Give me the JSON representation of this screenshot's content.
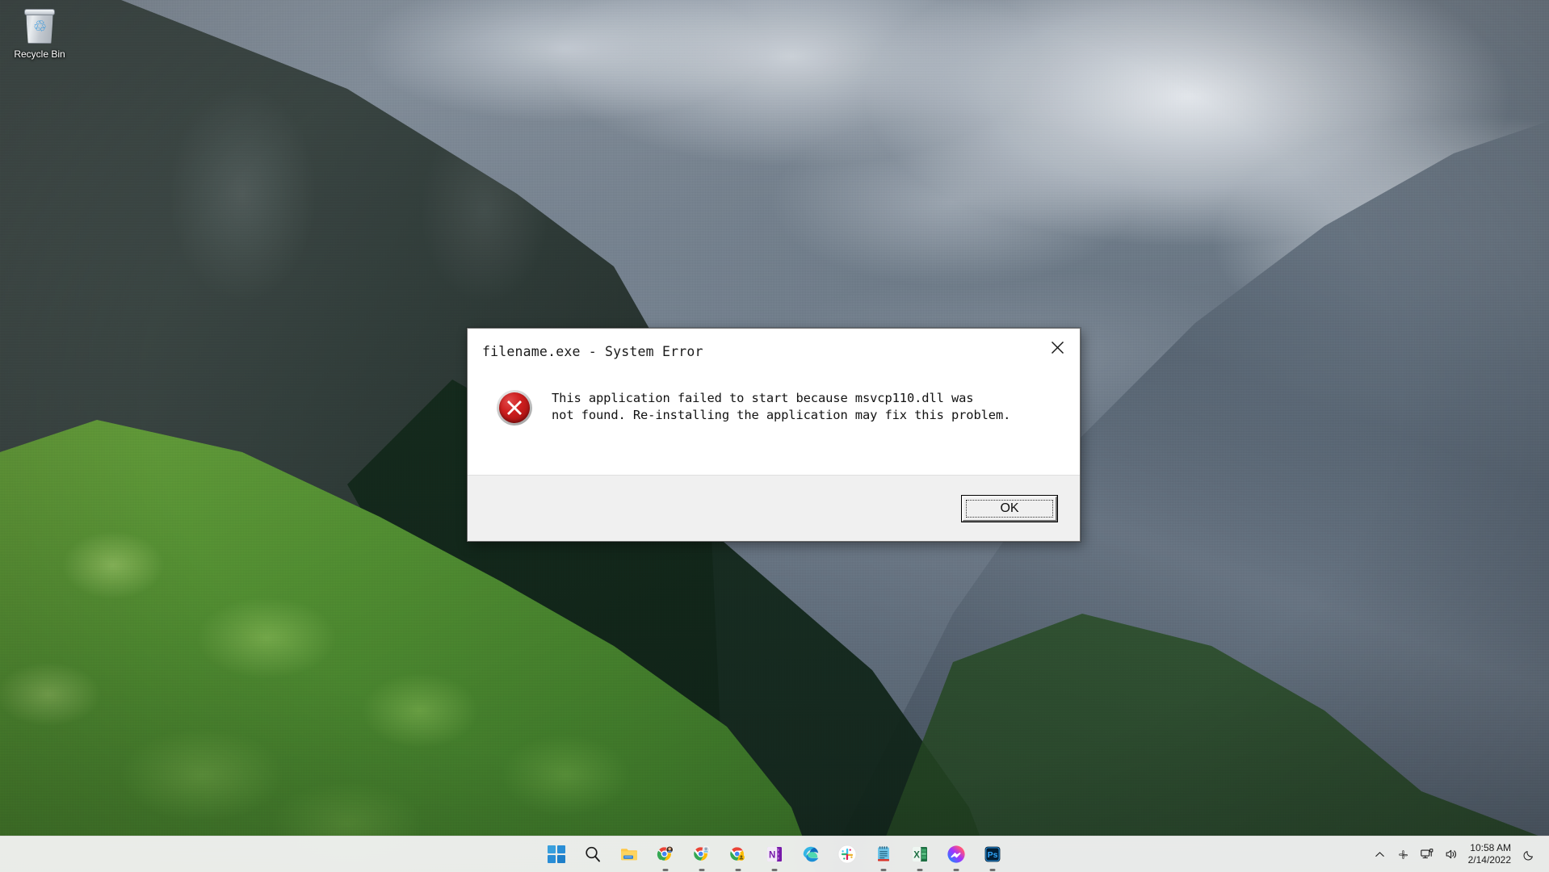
{
  "desktop": {
    "icons": [
      {
        "name": "recycle-bin",
        "label": "Recycle Bin",
        "glyph": "♲"
      }
    ]
  },
  "dialog": {
    "title": "filename.exe - System Error",
    "close_label": "×",
    "icon": "error-cross-icon",
    "message": "This application failed to start because msvcp110.dll was\nnot found. Re-installing the application may fix this problem.",
    "buttons": [
      {
        "name": "ok-button",
        "label": "OK",
        "focused": true
      }
    ],
    "colors": {
      "error_red": "#cf1f1f",
      "dialog_bg": "#ffffff",
      "footer_bg": "#f0f0f0",
      "border": "#6e6e6e"
    }
  },
  "taskbar": {
    "background": "#f3f3f3",
    "items": [
      {
        "name": "start-button",
        "icon": "windows-logo-icon",
        "label": "Start",
        "running": false
      },
      {
        "name": "search-button",
        "icon": "search-icon",
        "label": "Search",
        "running": false
      },
      {
        "name": "file-explorer-button",
        "icon": "file-explorer-icon",
        "label": "File Explorer",
        "running": false
      },
      {
        "name": "chrome-profile-1",
        "icon": "chrome-icon",
        "label": "Google Chrome",
        "running": true
      },
      {
        "name": "chrome-profile-2",
        "icon": "chrome-icon",
        "label": "Google Chrome",
        "running": true
      },
      {
        "name": "chrome-profile-3",
        "icon": "chrome-icon",
        "label": "Google Chrome",
        "running": true
      },
      {
        "name": "onenote-button",
        "icon": "onenote-icon",
        "label": "OneNote",
        "running": true
      },
      {
        "name": "edge-button",
        "icon": "microsoft-edge-icon",
        "label": "Microsoft Edge",
        "running": false
      },
      {
        "name": "slack-button",
        "icon": "slack-icon",
        "label": "Slack",
        "running": false
      },
      {
        "name": "notepad-button",
        "icon": "notepad-icon",
        "label": "Notepad",
        "running": true
      },
      {
        "name": "excel-button",
        "icon": "excel-icon",
        "label": "Microsoft Excel",
        "running": true
      },
      {
        "name": "messenger-button",
        "icon": "messenger-icon",
        "label": "Messenger",
        "running": true
      },
      {
        "name": "photoshop-button",
        "icon": "photoshop-icon",
        "label": "Adobe Photoshop",
        "running": true
      }
    ]
  },
  "tray": {
    "show_hidden_label": "Show hidden icons",
    "items": [
      {
        "name": "show-hidden-icons-button",
        "icon": "chevron-up-icon",
        "label": "Show hidden icons"
      },
      {
        "name": "slack-tray-icon",
        "icon": "slack-icon",
        "label": "Slack"
      },
      {
        "name": "network-button",
        "icon": "network-icon",
        "label": "Network"
      },
      {
        "name": "volume-button",
        "icon": "speaker-icon",
        "label": "Volume"
      }
    ],
    "clock": {
      "time": "10:58 AM",
      "date": "2/14/2022"
    },
    "notifications": {
      "name": "notification-center-button",
      "icon": "moon-icon",
      "label": "Notifications"
    }
  }
}
